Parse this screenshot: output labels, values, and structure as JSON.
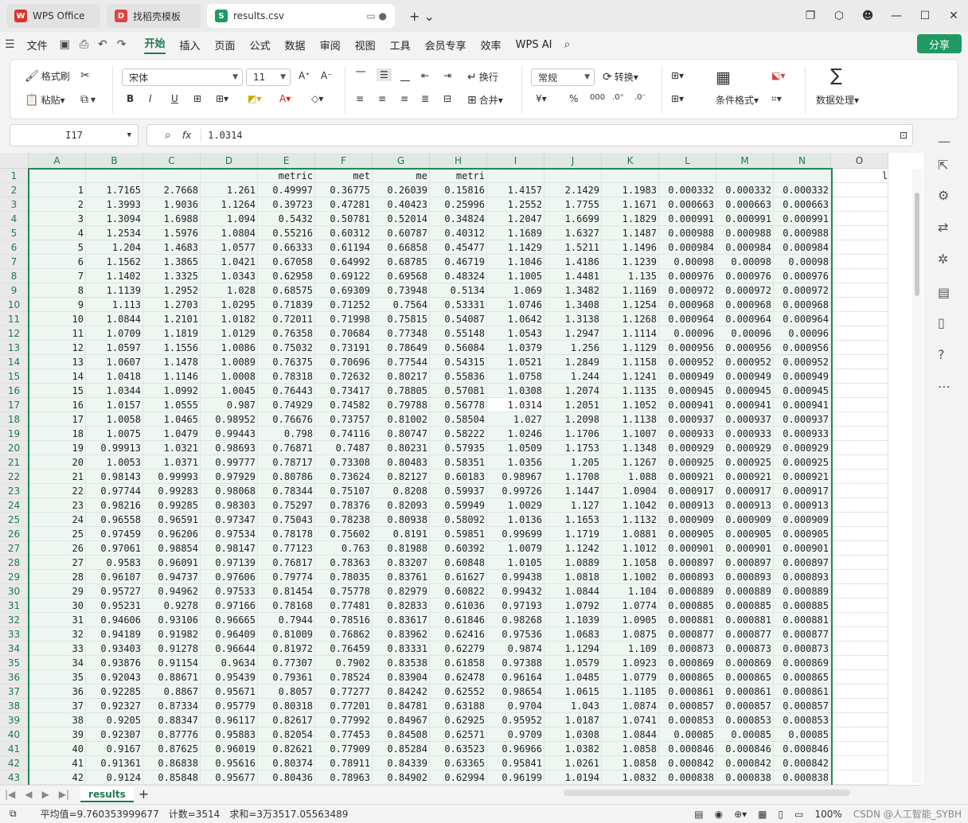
{
  "tabs": [
    {
      "label": "WPS Office",
      "logo": "W",
      "logo_color": "#d9342b",
      "active": false
    },
    {
      "label": "找稻壳模板",
      "logo": "D",
      "logo_color": "#e14141",
      "active": false
    },
    {
      "label": "results.csv",
      "logo": "S",
      "logo_color": "#1f9a63",
      "active": true
    }
  ],
  "menu": {
    "file": "文件",
    "items": [
      "开始",
      "插入",
      "页面",
      "公式",
      "数据",
      "审阅",
      "视图",
      "工具",
      "会员专享",
      "效率",
      "WPS AI"
    ],
    "active": "开始",
    "share": "分享"
  },
  "ribbon": {
    "format_painter": "格式刷",
    "paste": "粘贴",
    "font_name": "宋体",
    "font_size": "11",
    "wrap": "换行",
    "merge": "合并",
    "number_format": "常规",
    "convert": "转换",
    "conditional_format": "条件格式",
    "data_processing": "数据处理"
  },
  "formula_bar": {
    "name_box": "I17",
    "fx": "fx",
    "value": "1.0314"
  },
  "columns": [
    "A",
    "B",
    "C",
    "D",
    "E",
    "F",
    "G",
    "H",
    "I",
    "J",
    "K",
    "L",
    "M",
    "N",
    "O"
  ],
  "row_numbers": [
    "1",
    "2",
    "3",
    "4",
    "5",
    "6",
    "7",
    "8",
    "9",
    "10",
    "11",
    "12",
    "13",
    "14",
    "15",
    "16",
    "17",
    "18",
    "19",
    "20",
    "21",
    "22",
    "23",
    "24",
    "25",
    "26",
    "27",
    "28",
    "29",
    "30",
    "31",
    "32",
    "33",
    "34",
    "35",
    "36",
    "37",
    "38",
    "39",
    "40",
    "41",
    "42",
    "43"
  ],
  "header_row": [
    "",
    "",
    "",
    "",
    "metric",
    "met",
    "me",
    "metri",
    "",
    "",
    "",
    "",
    "",
    "",
    "lr/p"
  ],
  "rows": [
    [
      "1",
      "1.7165",
      "2.7668",
      "1.261",
      "0.49997",
      "0.36775",
      "0.26039",
      "0.15816",
      "1.4157",
      "2.1429",
      "1.1983",
      "0.000332",
      "0.000332",
      "0.000332"
    ],
    [
      "2",
      "1.3993",
      "1.9036",
      "1.1264",
      "0.39723",
      "0.47281",
      "0.40423",
      "0.25996",
      "1.2552",
      "1.7755",
      "1.1671",
      "0.000663",
      "0.000663",
      "0.000663"
    ],
    [
      "3",
      "1.3094",
      "1.6988",
      "1.094",
      "0.5432",
      "0.50781",
      "0.52014",
      "0.34824",
      "1.2047",
      "1.6699",
      "1.1829",
      "0.000991",
      "0.000991",
      "0.000991"
    ],
    [
      "4",
      "1.2534",
      "1.5976",
      "1.0804",
      "0.55216",
      "0.60312",
      "0.60787",
      "0.40312",
      "1.1689",
      "1.6327",
      "1.1487",
      "0.000988",
      "0.000988",
      "0.000988"
    ],
    [
      "5",
      "1.204",
      "1.4683",
      "1.0577",
      "0.66333",
      "0.61194",
      "0.66858",
      "0.45477",
      "1.1429",
      "1.5211",
      "1.1496",
      "0.000984",
      "0.000984",
      "0.000984"
    ],
    [
      "6",
      "1.1562",
      "1.3865",
      "1.0421",
      "0.67058",
      "0.64992",
      "0.68785",
      "0.46719",
      "1.1046",
      "1.4186",
      "1.1239",
      "0.00098",
      "0.00098",
      "0.00098"
    ],
    [
      "7",
      "1.1402",
      "1.3325",
      "1.0343",
      "0.62958",
      "0.69122",
      "0.69568",
      "0.48324",
      "1.1005",
      "1.4481",
      "1.135",
      "0.000976",
      "0.000976",
      "0.000976"
    ],
    [
      "8",
      "1.1139",
      "1.2952",
      "1.028",
      "0.68575",
      "0.69309",
      "0.73948",
      "0.5134",
      "1.069",
      "1.3482",
      "1.1169",
      "0.000972",
      "0.000972",
      "0.000972"
    ],
    [
      "9",
      "1.113",
      "1.2703",
      "1.0295",
      "0.71839",
      "0.71252",
      "0.7564",
      "0.53331",
      "1.0746",
      "1.3408",
      "1.1254",
      "0.000968",
      "0.000968",
      "0.000968"
    ],
    [
      "10",
      "1.0844",
      "1.2101",
      "1.0182",
      "0.72011",
      "0.71998",
      "0.75815",
      "0.54087",
      "1.0642",
      "1.3138",
      "1.1268",
      "0.000964",
      "0.000964",
      "0.000964"
    ],
    [
      "11",
      "1.0709",
      "1.1819",
      "1.0129",
      "0.76358",
      "0.70684",
      "0.77348",
      "0.55148",
      "1.0543",
      "1.2947",
      "1.1114",
      "0.00096",
      "0.00096",
      "0.00096"
    ],
    [
      "12",
      "1.0597",
      "1.1556",
      "1.0086",
      "0.75032",
      "0.73191",
      "0.78649",
      "0.56084",
      "1.0379",
      "1.256",
      "1.1129",
      "0.000956",
      "0.000956",
      "0.000956"
    ],
    [
      "13",
      "1.0607",
      "1.1478",
      "1.0089",
      "0.76375",
      "0.70696",
      "0.77544",
      "0.54315",
      "1.0521",
      "1.2849",
      "1.1158",
      "0.000952",
      "0.000952",
      "0.000952"
    ],
    [
      "14",
      "1.0418",
      "1.1146",
      "1.0008",
      "0.78318",
      "0.72632",
      "0.80217",
      "0.55836",
      "1.0758",
      "1.244",
      "1.1241",
      "0.000949",
      "0.000949",
      "0.000949"
    ],
    [
      "15",
      "1.0344",
      "1.0992",
      "1.0045",
      "0.76443",
      "0.73417",
      "0.78805",
      "0.57081",
      "1.0308",
      "1.2074",
      "1.1135",
      "0.000945",
      "0.000945",
      "0.000945"
    ],
    [
      "16",
      "1.0157",
      "1.0555",
      "0.987",
      "0.74929",
      "0.74582",
      "0.79788",
      "0.56778",
      "1.0314",
      "1.2051",
      "1.1052",
      "0.000941",
      "0.000941",
      "0.000941"
    ],
    [
      "17",
      "1.0058",
      "1.0465",
      "0.98952",
      "0.76676",
      "0.73757",
      "0.81002",
      "0.58504",
      "1.027",
      "1.2098",
      "1.1138",
      "0.000937",
      "0.000937",
      "0.000937"
    ],
    [
      "18",
      "1.0075",
      "1.0479",
      "0.99443",
      "0.798",
      "0.74116",
      "0.80747",
      "0.58222",
      "1.0246",
      "1.1706",
      "1.1007",
      "0.000933",
      "0.000933",
      "0.000933"
    ],
    [
      "19",
      "0.99913",
      "1.0321",
      "0.98693",
      "0.76871",
      "0.7487",
      "0.80231",
      "0.57935",
      "1.0509",
      "1.1753",
      "1.1348",
      "0.000929",
      "0.000929",
      "0.000929"
    ],
    [
      "20",
      "1.0053",
      "1.0371",
      "0.99777",
      "0.78717",
      "0.73308",
      "0.80483",
      "0.58351",
      "1.0356",
      "1.205",
      "1.1267",
      "0.000925",
      "0.000925",
      "0.000925"
    ],
    [
      "21",
      "0.98143",
      "0.99993",
      "0.97929",
      "0.80786",
      "0.73624",
      "0.82127",
      "0.60183",
      "0.98967",
      "1.1708",
      "1.088",
      "0.000921",
      "0.000921",
      "0.000921"
    ],
    [
      "22",
      "0.97744",
      "0.99283",
      "0.98068",
      "0.78344",
      "0.75107",
      "0.8208",
      "0.59937",
      "0.99726",
      "1.1447",
      "1.0904",
      "0.000917",
      "0.000917",
      "0.000917"
    ],
    [
      "23",
      "0.98216",
      "0.99285",
      "0.98303",
      "0.75297",
      "0.78376",
      "0.82093",
      "0.59949",
      "1.0029",
      "1.127",
      "1.1042",
      "0.000913",
      "0.000913",
      "0.000913"
    ],
    [
      "24",
      "0.96558",
      "0.96591",
      "0.97347",
      "0.75043",
      "0.78238",
      "0.80938",
      "0.58092",
      "1.0136",
      "1.1653",
      "1.1132",
      "0.000909",
      "0.000909",
      "0.000909"
    ],
    [
      "25",
      "0.97459",
      "0.96206",
      "0.97534",
      "0.78178",
      "0.75602",
      "0.8191",
      "0.59851",
      "0.99699",
      "1.1719",
      "1.0881",
      "0.000905",
      "0.000905",
      "0.000905"
    ],
    [
      "26",
      "0.97061",
      "0.98854",
      "0.98147",
      "0.77123",
      "0.763",
      "0.81988",
      "0.60392",
      "1.0079",
      "1.1242",
      "1.1012",
      "0.000901",
      "0.000901",
      "0.000901"
    ],
    [
      "27",
      "0.9583",
      "0.96091",
      "0.97139",
      "0.76817",
      "0.78363",
      "0.83207",
      "0.60848",
      "1.0105",
      "1.0889",
      "1.1058",
      "0.000897",
      "0.000897",
      "0.000897"
    ],
    [
      "28",
      "0.96107",
      "0.94737",
      "0.97606",
      "0.79774",
      "0.78035",
      "0.83761",
      "0.61627",
      "0.99438",
      "1.0818",
      "1.1002",
      "0.000893",
      "0.000893",
      "0.000893"
    ],
    [
      "29",
      "0.95727",
      "0.94962",
      "0.97533",
      "0.81454",
      "0.75778",
      "0.82979",
      "0.60822",
      "0.99432",
      "1.0844",
      "1.104",
      "0.000889",
      "0.000889",
      "0.000889"
    ],
    [
      "30",
      "0.95231",
      "0.9278",
      "0.97166",
      "0.78168",
      "0.77481",
      "0.82833",
      "0.61036",
      "0.97193",
      "1.0792",
      "1.0774",
      "0.000885",
      "0.000885",
      "0.000885"
    ],
    [
      "31",
      "0.94606",
      "0.93106",
      "0.96665",
      "0.7944",
      "0.78516",
      "0.83617",
      "0.61846",
      "0.98268",
      "1.1039",
      "1.0905",
      "0.000881",
      "0.000881",
      "0.000881"
    ],
    [
      "32",
      "0.94189",
      "0.91982",
      "0.96409",
      "0.81009",
      "0.76862",
      "0.83962",
      "0.62416",
      "0.97536",
      "1.0683",
      "1.0875",
      "0.000877",
      "0.000877",
      "0.000877"
    ],
    [
      "33",
      "0.93403",
      "0.91278",
      "0.96644",
      "0.81972",
      "0.76459",
      "0.83331",
      "0.62279",
      "0.9874",
      "1.1294",
      "1.109",
      "0.000873",
      "0.000873",
      "0.000873"
    ],
    [
      "34",
      "0.93876",
      "0.91154",
      "0.9634",
      "0.77307",
      "0.7902",
      "0.83538",
      "0.61858",
      "0.97388",
      "1.0579",
      "1.0923",
      "0.000869",
      "0.000869",
      "0.000869"
    ],
    [
      "35",
      "0.92043",
      "0.88671",
      "0.95439",
      "0.79361",
      "0.78524",
      "0.83904",
      "0.62478",
      "0.96164",
      "1.0485",
      "1.0779",
      "0.000865",
      "0.000865",
      "0.000865"
    ],
    [
      "36",
      "0.92285",
      "0.8867",
      "0.95671",
      "0.8057",
      "0.77277",
      "0.84242",
      "0.62552",
      "0.98654",
      "1.0615",
      "1.1105",
      "0.000861",
      "0.000861",
      "0.000861"
    ],
    [
      "37",
      "0.92327",
      "0.87334",
      "0.95779",
      "0.80318",
      "0.77201",
      "0.84781",
      "0.63188",
      "0.9704",
      "1.043",
      "1.0874",
      "0.000857",
      "0.000857",
      "0.000857"
    ],
    [
      "38",
      "0.9205",
      "0.88347",
      "0.96117",
      "0.82617",
      "0.77992",
      "0.84967",
      "0.62925",
      "0.95952",
      "1.0187",
      "1.0741",
      "0.000853",
      "0.000853",
      "0.000853"
    ],
    [
      "39",
      "0.92307",
      "0.87776",
      "0.95883",
      "0.82054",
      "0.77453",
      "0.84508",
      "0.62571",
      "0.9709",
      "1.0308",
      "1.0844",
      "0.00085",
      "0.00085",
      "0.00085"
    ],
    [
      "40",
      "0.9167",
      "0.87625",
      "0.96019",
      "0.82621",
      "0.77909",
      "0.85284",
      "0.63523",
      "0.96966",
      "1.0382",
      "1.0858",
      "0.000846",
      "0.000846",
      "0.000846"
    ],
    [
      "41",
      "0.91361",
      "0.86838",
      "0.95616",
      "0.80374",
      "0.78911",
      "0.84339",
      "0.63365",
      "0.95841",
      "1.0261",
      "1.0858",
      "0.000842",
      "0.000842",
      "0.000842"
    ],
    [
      "42",
      "0.9124",
      "0.85848",
      "0.95677",
      "0.80436",
      "0.78963",
      "0.84902",
      "0.62994",
      "0.96199",
      "1.0194",
      "1.0832",
      "0.000838",
      "0.000838",
      "0.000838"
    ]
  ],
  "active_cell": {
    "row": 17,
    "col": 8
  },
  "sheet_tab": "results",
  "status": {
    "average": "平均值=9.760353999677",
    "count": "计数=3514",
    "sum": "求和=3万3517.05563489",
    "zoom": "100%"
  },
  "watermark": "CSDN @人工智能_SYBH",
  "colors": {
    "accent": "#1f7a4f",
    "selection_fill": "#eef6f1",
    "share": "#1f9a63"
  }
}
